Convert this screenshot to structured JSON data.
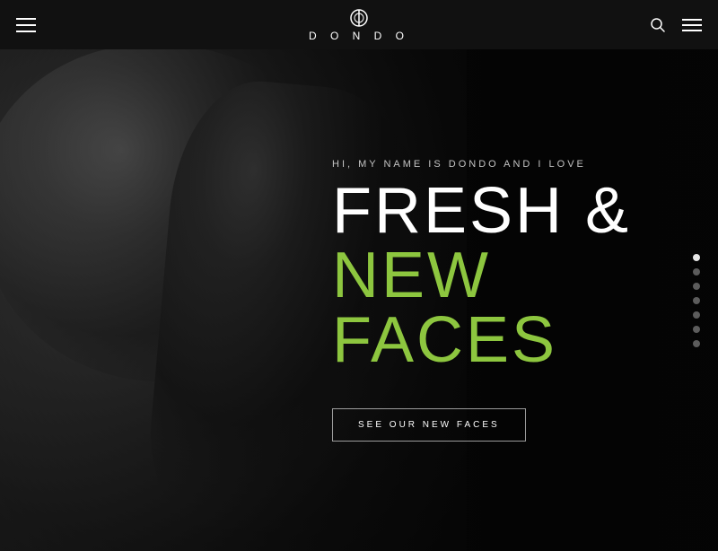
{
  "header": {
    "logo_text": "D O N D O",
    "hamburger_label": "Menu",
    "search_label": "Search",
    "nav_label": "Navigation"
  },
  "hero": {
    "subtitle": "HI, MY NAME IS DONDO AND I LOVE",
    "title_line1": "FRESH &",
    "title_line2": "NEW FACES",
    "cta_button": "SEE OUR NEW FACES",
    "accent_color": "#8dc63f"
  },
  "dot_nav": {
    "dots": [
      {
        "id": 1,
        "active": true
      },
      {
        "id": 2,
        "active": false
      },
      {
        "id": 3,
        "active": false
      },
      {
        "id": 4,
        "active": false
      },
      {
        "id": 5,
        "active": false
      },
      {
        "id": 6,
        "active": false
      },
      {
        "id": 7,
        "active": false
      }
    ]
  }
}
